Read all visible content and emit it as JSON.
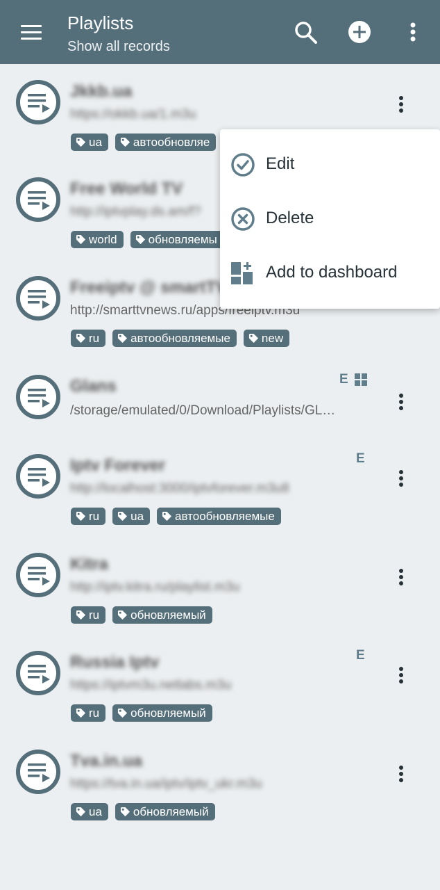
{
  "appbar": {
    "title": "Playlists",
    "subtitle": "Show all records",
    "icons": [
      "menu-icon",
      "search-icon",
      "add-circle-icon",
      "more-vert-icon"
    ]
  },
  "colors": {
    "appbar": "#546e7a",
    "background": "#eceff1",
    "tag": "#546e7a",
    "icon": "#607d8b"
  },
  "rows": [
    {
      "name": "Jkkb.ua",
      "url": "https://okkb.ua/1.m3u",
      "tags": [
        "ua",
        "автообновляе"
      ],
      "flags": ""
    },
    {
      "name": "Free World TV",
      "url": "http://iptvplay.ds.am/f?",
      "tags": [
        "world",
        "обновляемы"
      ],
      "flags": ""
    },
    {
      "name": "Freeiptv @ smartTV",
      "url": "http://smarttvnews.ru/apps/freeiptv.m3u",
      "tags": [
        "ru",
        "автообновляемые",
        "new"
      ],
      "flags": ""
    },
    {
      "name": "Glans",
      "url": "/storage/emulated/0/Download/Playlists/GL…",
      "tags": [],
      "flags": "E"
    },
    {
      "name": "Iptv Forever",
      "url": "http://localhost:3000/iptvforever.m3u8",
      "tags": [
        "ru",
        "ua",
        "автообновляемые"
      ],
      "flags": "E"
    },
    {
      "name": "Kitra",
      "url": "http://iptv.kitra.ru/playlist.m3u",
      "tags": [
        "ru",
        "обновляемый"
      ],
      "flags": ""
    },
    {
      "name": "Russia Iptv",
      "url": "https://iptvm3u.netlabs.m3u",
      "tags": [
        "ru",
        "обновляемый"
      ],
      "flags": "E"
    },
    {
      "name": "Tva.in.ua",
      "url": "https://tva.in.ua/iptv/iptv_ukr.m3u",
      "tags": [
        "ua",
        "обновляемый"
      ],
      "flags": ""
    }
  ],
  "context_menu": {
    "items": [
      {
        "label": "Edit",
        "icon": "check-circle-icon"
      },
      {
        "label": "Delete",
        "icon": "cancel-circle-icon"
      },
      {
        "label": "Add to dashboard",
        "icon": "dashboard-add-icon"
      }
    ]
  }
}
